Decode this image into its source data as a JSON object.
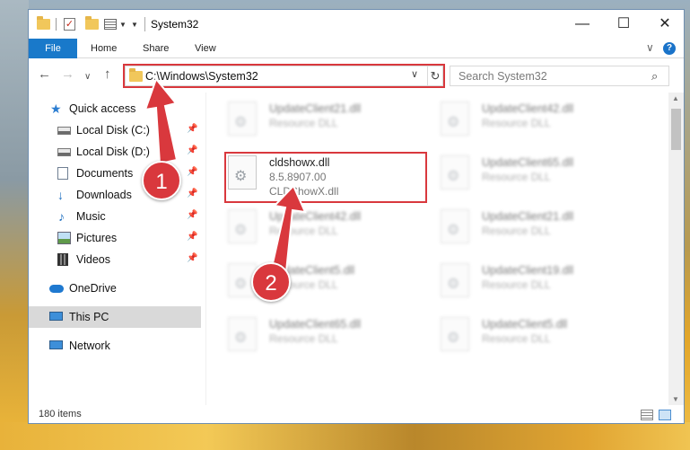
{
  "window": {
    "title": "System32",
    "minimize": "—",
    "maximize": "☐",
    "close": "✕"
  },
  "quick_access_toolbar": {
    "dropdown": "▼"
  },
  "ribbon": {
    "tabs": [
      "File",
      "Home",
      "Share",
      "View"
    ],
    "expand": "∨",
    "help": "?"
  },
  "nav": {
    "back": "←",
    "forward": "→",
    "recent": "∨",
    "up": "↑",
    "address": "C:\\Windows\\System32",
    "address_dropdown": "∨",
    "refresh": "↻",
    "search_placeholder": "Search System32",
    "search_icon": "search-icon"
  },
  "sidebar": {
    "items": [
      {
        "label": "Quick access",
        "icon": "star-icon",
        "pinned": false
      },
      {
        "label": "Local Disk (C:)",
        "icon": "disk-icon",
        "pinned": true
      },
      {
        "label": "Local Disk (D:)",
        "icon": "disk-icon",
        "pinned": true
      },
      {
        "label": "Documents",
        "icon": "documents-icon",
        "pinned": true
      },
      {
        "label": "Downloads",
        "icon": "download-icon",
        "pinned": true
      },
      {
        "label": "Music",
        "icon": "music-icon",
        "pinned": true
      },
      {
        "label": "Pictures",
        "icon": "pictures-icon",
        "pinned": true
      },
      {
        "label": "Videos",
        "icon": "videos-icon",
        "pinned": true
      },
      {
        "label": "OneDrive",
        "icon": "onedrive-icon",
        "pinned": false
      },
      {
        "label": "This PC",
        "icon": "pc-icon",
        "pinned": false,
        "selected": true
      },
      {
        "label": "Network",
        "icon": "network-icon",
        "pinned": false
      }
    ],
    "pin_glyph": "📌"
  },
  "files": {
    "left_column": [
      {
        "name": "UpdateClient21.dll",
        "type": "Resource DLL",
        "blurred": true
      },
      {
        "name": "cldshowx.dll",
        "version": "8.5.8907.00",
        "description": "CLDShowX.dll",
        "blurred": false,
        "highlighted": true
      },
      {
        "name": "UpdateClient42.dll",
        "type": "Resource DLL",
        "blurred": true
      },
      {
        "name": "UpdateClient5.dll",
        "type": "Resource DLL",
        "blurred": true
      },
      {
        "name": "UpdateClient65.dll",
        "type": "Resource DLL",
        "blurred": true
      }
    ],
    "right_column": [
      {
        "name": "UpdateClient42.dll",
        "type": "Resource DLL",
        "blurred": true
      },
      {
        "name": "UpdateClient65.dll",
        "type": "Resource DLL",
        "blurred": true
      },
      {
        "name": "UpdateClient21.dll",
        "type": "Resource DLL",
        "blurred": true
      },
      {
        "name": "UpdateClient19.dll",
        "type": "Resource DLL",
        "blurred": true
      },
      {
        "name": "UpdateClient5.dll",
        "type": "Resource DLL",
        "blurred": true
      }
    ]
  },
  "scrollbar": {
    "up": "▲",
    "down": "▼"
  },
  "status": {
    "item_count": "180 items"
  },
  "callouts": {
    "step1": "1",
    "step2": "2"
  },
  "colors": {
    "accent": "#1979ca",
    "highlight": "#d9383d"
  }
}
